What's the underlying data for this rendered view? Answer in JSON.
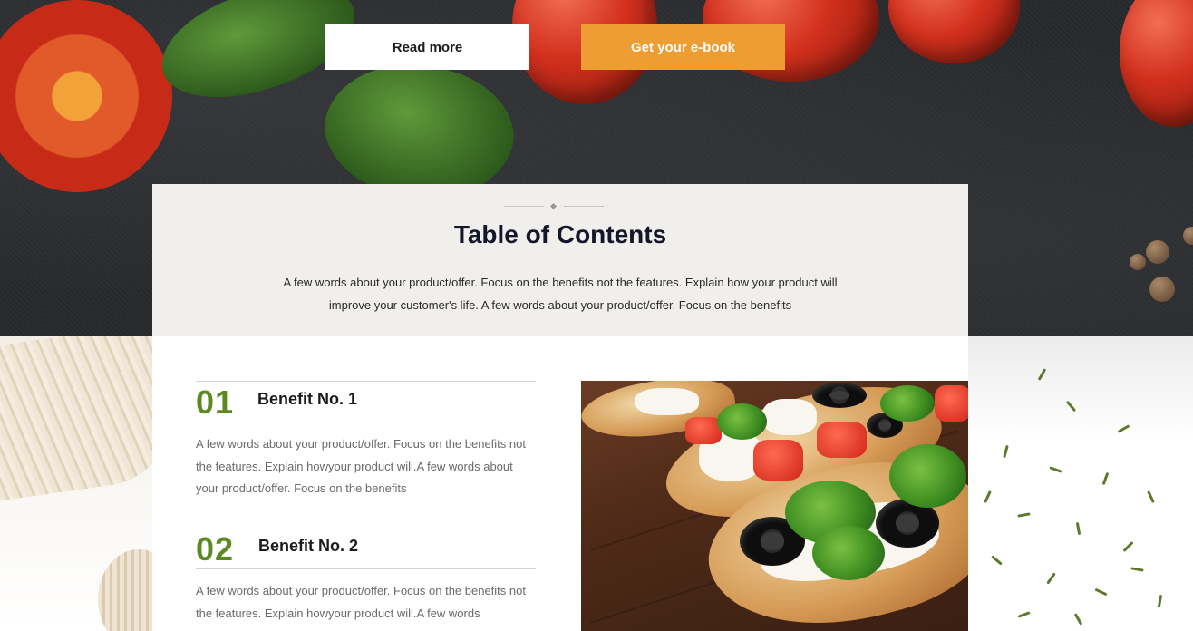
{
  "hero": {
    "read_more_label": "Read more",
    "ebook_label": "Get your e-book",
    "colors": {
      "ebook_button": "#ee9d33",
      "read_more_button": "#ffffff"
    }
  },
  "toc": {
    "title": "Table of Contents",
    "description": "A few words about your product/offer. Focus on the benefits not the features. Explain how your product will improve your customer's life. A few words about your product/offer. Focus on the benefits"
  },
  "benefits": [
    {
      "number": "01",
      "title": "Benefit No. 1",
      "description": "A few words about your product/offer. Focus on the benefits not the features. Explain howyour product will.A few words about your product/offer. Focus on the benefits"
    },
    {
      "number": "02",
      "title": "Benefit No. 2",
      "description": "A few words about your product/offer. Focus on the benefits not the features. Explain howyour product will.A few words"
    }
  ],
  "accent_colors": {
    "benefit_number": "#5c8a21",
    "title": "#14162a"
  }
}
